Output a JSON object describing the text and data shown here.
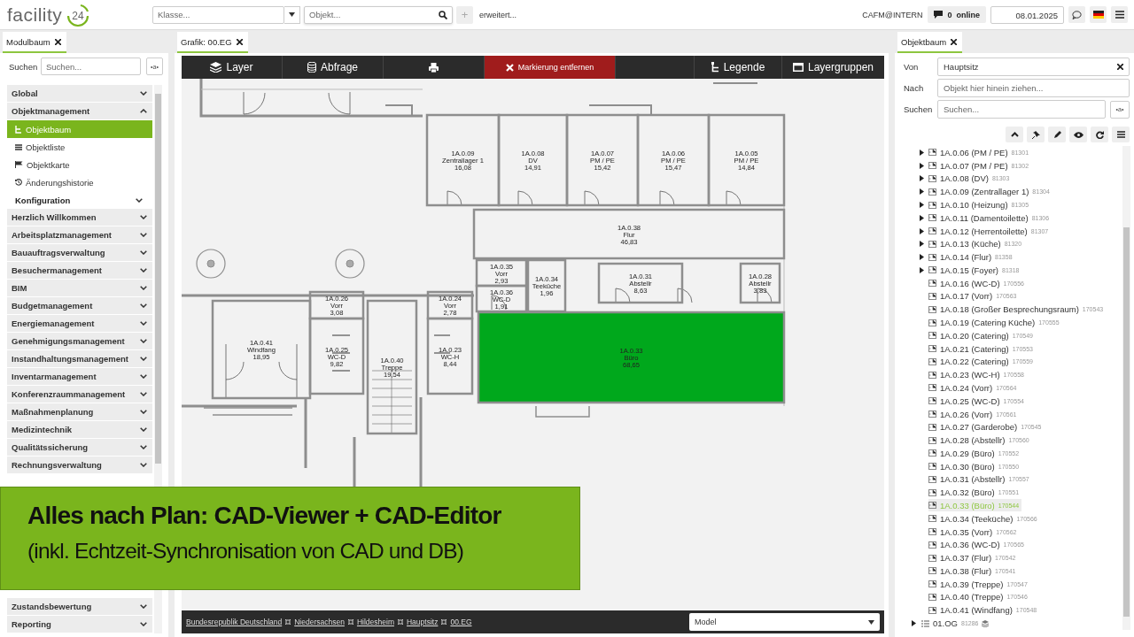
{
  "header": {
    "logo_text": "facility",
    "logo_badge": "24",
    "class_field": {
      "placeholder": "Klasse..."
    },
    "object_field": {
      "placeholder": "Objekt..."
    },
    "add_button": "+",
    "advanced_link": "erweitert...",
    "user": "CAFM@INTERN",
    "online_count": "0",
    "online_label": "online",
    "date": "08.01.2025"
  },
  "left_panel": {
    "tab": "Modulbaum",
    "search_label": "Suchen",
    "search": {
      "placeholder": "Suchen..."
    },
    "search_option": "•a•",
    "modules": [
      {
        "label": "Global",
        "expanded": false
      },
      {
        "label": "Objektmanagement",
        "expanded": true,
        "children": [
          {
            "kind": "link",
            "label": "Objektbaum",
            "selected": true
          },
          {
            "kind": "link",
            "label": "Objektliste",
            "selected": false
          },
          {
            "kind": "link",
            "label": "Objektkarte",
            "selected": false
          },
          {
            "kind": "link",
            "label": "Änderungshistorie",
            "selected": false
          },
          {
            "kind": "group",
            "label": "Konfiguration",
            "expanded": false
          }
        ]
      },
      {
        "label": "Herzlich Willkommen",
        "expanded": false
      },
      {
        "label": "Arbeitsplatzmanagement",
        "expanded": false
      },
      {
        "label": "Bauauftragsverwaltung",
        "expanded": false
      },
      {
        "label": "Besuchermanagement",
        "expanded": false
      },
      {
        "label": "BIM",
        "expanded": false
      },
      {
        "label": "Budgetmanagement",
        "expanded": false
      },
      {
        "label": "Energiemanagement",
        "expanded": false
      },
      {
        "label": "Genehmigungsmanagement",
        "expanded": false
      },
      {
        "label": "Instandhaltungsmanagement",
        "expanded": false
      },
      {
        "label": "Inventarmanagement",
        "expanded": false
      },
      {
        "label": "Konferenzraummanagement",
        "expanded": false
      },
      {
        "label": "Maßnahmenplanung",
        "expanded": false
      },
      {
        "label": "Medizintechnik",
        "expanded": false
      },
      {
        "label": "Qualitätssicherung",
        "expanded": false
      },
      {
        "label": "Rechnungsverwaltung",
        "expanded": false
      },
      {
        "label": "Zustandsbewertung",
        "expanded": false
      },
      {
        "label": "Reporting",
        "expanded": false
      }
    ]
  },
  "center": {
    "tab": "Grafik: 00.EG",
    "toolbar_left": [
      {
        "kind": "plain",
        "label": "Layer"
      },
      {
        "kind": "plain",
        "label": "Abfrage"
      },
      {
        "kind": "plain"
      },
      {
        "kind": "danger",
        "label": "Markierung entfernen"
      }
    ],
    "toolbar_right": [
      {
        "label": "Legende"
      },
      {
        "label": "Layergruppen"
      }
    ],
    "floor_plan": [
      {
        "number": "1A.0.09",
        "name": "Zentrallager 1",
        "area": "16,08",
        "highlighted": false
      },
      {
        "number": "1A.0.08",
        "name": "DV",
        "area": "14,91",
        "highlighted": false
      },
      {
        "number": "1A.0.07",
        "name": "PM / PE",
        "area": "15,42",
        "highlighted": false
      },
      {
        "number": "1A.0.06",
        "name": "PM / PE",
        "area": "15,47",
        "highlighted": false
      },
      {
        "number": "1A.0.05",
        "name": "PM / PE",
        "area": "14,84",
        "highlighted": false
      },
      {
        "number": "1A.0.38",
        "name": "Flur",
        "area": "46,83",
        "highlighted": false
      },
      {
        "number": "1A.0.35",
        "name": "Vorr",
        "area": "2,93",
        "highlighted": false
      },
      {
        "number": "1A.0.36",
        "name": "WC-D",
        "area": "1,91",
        "highlighted": false
      },
      {
        "number": "1A.0.34",
        "name": "Teeküche",
        "area": "1,96",
        "highlighted": false
      },
      {
        "number": "1A.0.31",
        "name": "Abstellr",
        "area": "8,63",
        "highlighted": false
      },
      {
        "number": "1A.0.28",
        "name": "Abstellr",
        "area": "3,83",
        "highlighted": false
      },
      {
        "number": "1A.0.26",
        "name": "Vorr",
        "area": "3,08",
        "highlighted": false
      },
      {
        "number": "1A.0.41",
        "name": "Windfang",
        "area": "18,95",
        "highlighted": false
      },
      {
        "number": "1A.0.25",
        "name": "WC-D",
        "area": "9,82",
        "highlighted": false
      },
      {
        "number": "1A.0.40",
        "name": "Treppe",
        "area": "19,54",
        "highlighted": false
      },
      {
        "number": "1A.0.24",
        "name": "Vorr",
        "area": "2,78",
        "highlighted": false
      },
      {
        "number": "1A.0.23",
        "name": "WC-H",
        "area": "8,44",
        "highlighted": false
      },
      {
        "number": "1A.0.33",
        "name": "Büro",
        "area": "68,65",
        "highlighted": true
      }
    ],
    "breadcrumb": [
      "Bundesrepublik Deutschland",
      "Niedersachsen",
      "Hildesheim",
      "Hauptsitz",
      "00.EG"
    ],
    "layout_select": "Model"
  },
  "right_panel": {
    "tab": "Objektbaum",
    "from_label": "Von",
    "from_value": "Hauptsitz",
    "to_label": "Nach",
    "to_placeholder": "Objekt hier hinein ziehen...",
    "search_label": "Suchen",
    "search_placeholder": "Suchen...",
    "search_option": "•a•",
    "rooms": [
      {
        "label": "1A.0.06 (PM / PE)",
        "code": "81301",
        "expandable": true,
        "selected": false
      },
      {
        "label": "1A.0.07 (PM / PE)",
        "code": "81302",
        "expandable": true,
        "selected": false
      },
      {
        "label": "1A.0.08 (DV)",
        "code": "81303",
        "expandable": true,
        "selected": false
      },
      {
        "label": "1A.0.09 (Zentrallager 1)",
        "code": "81304",
        "expandable": true,
        "selected": false
      },
      {
        "label": "1A.0.10 (Heizung)",
        "code": "81305",
        "expandable": true,
        "selected": false
      },
      {
        "label": "1A.0.11 (Damentoilette)",
        "code": "81306",
        "expandable": true,
        "selected": false
      },
      {
        "label": "1A.0.12 (Herrentoilette)",
        "code": "81307",
        "expandable": true,
        "selected": false
      },
      {
        "label": "1A.0.13 (Küche)",
        "code": "81320",
        "expandable": true,
        "selected": false
      },
      {
        "label": "1A.0.14 (Flur)",
        "code": "81358",
        "expandable": true,
        "selected": false
      },
      {
        "label": "1A.0.15 (Foyer)",
        "code": "81318",
        "expandable": true,
        "selected": false
      },
      {
        "label": "1A.0.16 (WC-D)",
        "code": "170556",
        "expandable": false,
        "selected": false
      },
      {
        "label": "1A.0.17 (Vorr)",
        "code": "170563",
        "expandable": false,
        "selected": false
      },
      {
        "label": "1A.0.18 (Großer Besprechungsraum)",
        "code": "170543",
        "expandable": false,
        "selected": false
      },
      {
        "label": "1A.0.19 (Catering Küche)",
        "code": "170555",
        "expandable": false,
        "selected": false
      },
      {
        "label": "1A.0.20 (Catering)",
        "code": "170549",
        "expandable": false,
        "selected": false
      },
      {
        "label": "1A.0.21 (Catering)",
        "code": "170553",
        "expandable": false,
        "selected": false
      },
      {
        "label": "1A.0.22 (Catering)",
        "code": "170559",
        "expandable": false,
        "selected": false
      },
      {
        "label": "1A.0.23 (WC-H)",
        "code": "170558",
        "expandable": false,
        "selected": false
      },
      {
        "label": "1A.0.24 (Vorr)",
        "code": "170564",
        "expandable": false,
        "selected": false
      },
      {
        "label": "1A.0.25 (WC-D)",
        "code": "170554",
        "expandable": false,
        "selected": false
      },
      {
        "label": "1A.0.26 (Vorr)",
        "code": "170561",
        "expandable": false,
        "selected": false
      },
      {
        "label": "1A.0.27 (Garderobe)",
        "code": "170545",
        "expandable": false,
        "selected": false
      },
      {
        "label": "1A.0.28 (Abstellr)",
        "code": "170560",
        "expandable": false,
        "selected": false
      },
      {
        "label": "1A.0.29 (Büro)",
        "code": "170552",
        "expandable": false,
        "selected": false
      },
      {
        "label": "1A.0.30 (Büro)",
        "code": "170550",
        "expandable": false,
        "selected": false
      },
      {
        "label": "1A.0.31 (Abstellr)",
        "code": "170557",
        "expandable": false,
        "selected": false
      },
      {
        "label": "1A.0.32 (Büro)",
        "code": "170551",
        "expandable": false,
        "selected": false
      },
      {
        "label": "1A.0.33 (Büro)",
        "code": "170544",
        "expandable": false,
        "selected": true
      },
      {
        "label": "1A.0.34 (Teeküche)",
        "code": "170566",
        "expandable": false,
        "selected": false
      },
      {
        "label": "1A.0.35 (Vorr)",
        "code": "170562",
        "expandable": false,
        "selected": false
      },
      {
        "label": "1A.0.36 (WC-D)",
        "code": "170565",
        "expandable": false,
        "selected": false
      },
      {
        "label": "1A.0.37 (Flur)",
        "code": "170542",
        "expandable": false,
        "selected": false
      },
      {
        "label": "1A.0.38 (Flur)",
        "code": "170541",
        "expandable": false,
        "selected": false
      },
      {
        "label": "1A.0.39 (Treppe)",
        "code": "170547",
        "expandable": false,
        "selected": false
      },
      {
        "label": "1A.0.40 (Treppe)",
        "code": "170546",
        "expandable": false,
        "selected": false
      },
      {
        "label": "1A.0.41 (Windfang)",
        "code": "170548",
        "expandable": false,
        "selected": false
      }
    ],
    "floors": [
      {
        "label": "01.OG",
        "code": "81286",
        "expanded": false
      }
    ]
  },
  "banner": {
    "title": "Alles nach Plan: CAD-Viewer + CAD-Editor",
    "subtitle": "(inkl. Echtzeit-Synchronisation von CAD und DB)"
  }
}
